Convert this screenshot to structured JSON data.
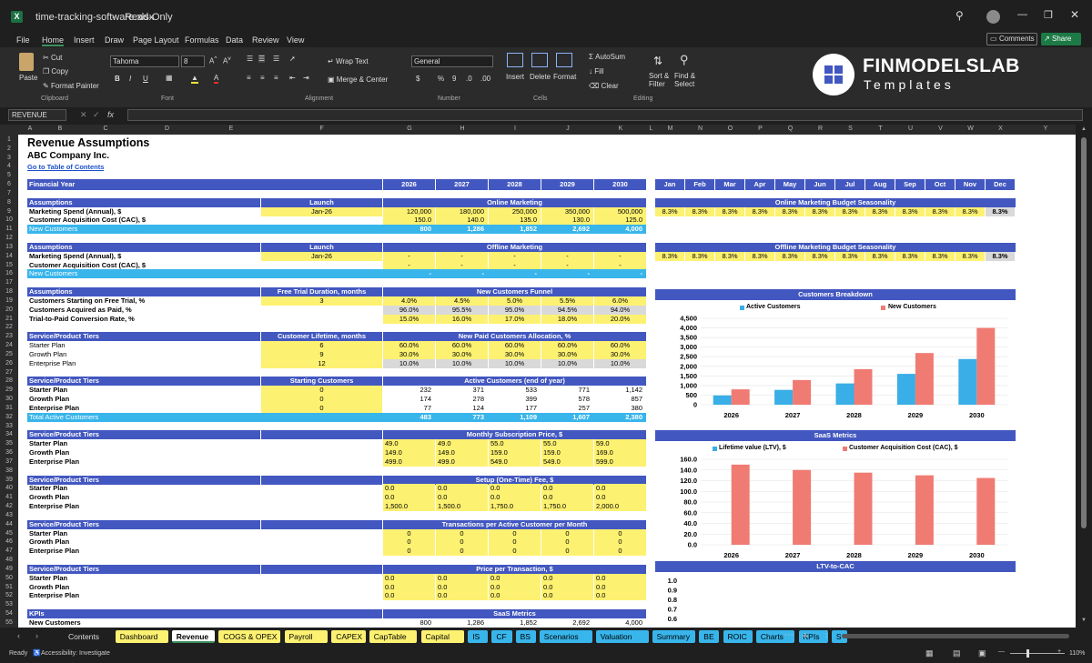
{
  "titlebar": {
    "filename": "time-tracking-software.xlsx",
    "mode": "Read-Only"
  },
  "menu": {
    "items": [
      "File",
      "Home",
      "Insert",
      "Draw",
      "Page Layout",
      "Formulas",
      "Data",
      "Review",
      "View"
    ],
    "comments": "Comments",
    "share": "Share"
  },
  "ribbon": {
    "paste": "Paste",
    "cut": "Cut",
    "copy": "Copy",
    "format_painter": "Format Painter",
    "clipboard": "Clipboard",
    "font_name": "Tahoma",
    "font_size": "8",
    "font": "Font",
    "wrap": "Wrap Text",
    "merge": "Merge & Center",
    "alignment": "Alignment",
    "number_format": "General",
    "number": "Number",
    "insert": "Insert",
    "delete": "Delete",
    "format": "Format",
    "cells": "Cells",
    "autosum": "AutoSum",
    "fill": "Fill",
    "clear": "Clear",
    "sort": "Sort &",
    "filter": "Filter",
    "find": "Find &",
    "select": "Select",
    "editing": "Editing",
    "brand_top": "FINMODELSLAB",
    "brand_bottom": "Templates"
  },
  "formula": {
    "namebox": "REVENUE",
    "fx": "fx",
    "content": ""
  },
  "columns": [
    "A",
    "B",
    "C",
    "D",
    "E",
    "F",
    "G",
    "H",
    "I",
    "J",
    "K",
    "L",
    "M",
    "N",
    "O",
    "P",
    "Q",
    "R",
    "S",
    "T",
    "U",
    "V",
    "W",
    "X",
    "Y"
  ],
  "rows": [
    "1",
    "2",
    "3",
    "4",
    "5",
    "6",
    "7",
    "8",
    "9",
    "10",
    "11",
    "12",
    "13",
    "14",
    "15",
    "16",
    "17",
    "18",
    "19",
    "20",
    "21",
    "22",
    "23",
    "24",
    "25",
    "26",
    "27",
    "28",
    "29",
    "30",
    "31",
    "32",
    "33",
    "34",
    "35",
    "36",
    "37",
    "38",
    "39",
    "40",
    "41",
    "42",
    "43",
    "44",
    "45",
    "46",
    "47",
    "48",
    "49",
    "50",
    "51",
    "52",
    "53",
    "54",
    "55"
  ],
  "sheet": {
    "title": "Revenue Assumptions",
    "company": "ABC Company Inc.",
    "toc": "Go to Table of Contents",
    "financial_year": "Financial Year",
    "years": [
      "2026",
      "2027",
      "2028",
      "2029",
      "2030"
    ],
    "months": [
      "Jan",
      "Feb",
      "Mar",
      "Apr",
      "May",
      "Jun",
      "Jul",
      "Aug",
      "Sep",
      "Oct",
      "Nov",
      "Dec"
    ],
    "assumptions": "Assumptions",
    "launch": "Launch",
    "online_marketing": "Online Marketing",
    "offline_marketing": "Offline Marketing",
    "mkt_spend": "Marketing Spend (Annual), $",
    "cac": "Customer Acquisition Cost (CAC), $",
    "new_customers": "New Customers",
    "online_launch": "Jan-26",
    "online_spend": [
      "120,000",
      "180,000",
      "250,000",
      "350,000",
      "500,000"
    ],
    "online_cac": [
      "150.0",
      "140.0",
      "135.0",
      "130.0",
      "125.0"
    ],
    "online_new": [
      "800",
      "1,286",
      "1,852",
      "2,692",
      "4,000"
    ],
    "offline_launch": "Jan-26",
    "offline_spend": [
      "-",
      "-",
      "-",
      "-",
      "-"
    ],
    "offline_cac": [
      "-",
      "-",
      "-",
      "-",
      "-"
    ],
    "offline_new": [
      "-",
      "-",
      "-",
      "-",
      "-"
    ],
    "online_season_title": "Online Marketing Budget Seasonality",
    "offline_season_title": "Offline Marketing Budget Seasonality",
    "season": [
      "8.3%",
      "8.3%",
      "8.3%",
      "8.3%",
      "8.3%",
      "8.3%",
      "8.3%",
      "8.3%",
      "8.3%",
      "8.3%",
      "8.3%",
      "8.3%"
    ],
    "trial_duration_label": "Free Trial Duration, months",
    "funnel": "New Customers Funnel",
    "trial_duration": "3",
    "funnel_rows": [
      {
        "label": "Customers Starting on Free Trial, %",
        "v": [
          "4.0%",
          "4.5%",
          "5.0%",
          "5.5%",
          "6.0%"
        ]
      },
      {
        "label": "Customers Acquired as Paid, %",
        "v": [
          "96.0%",
          "95.5%",
          "95.0%",
          "94.5%",
          "94.0%"
        ]
      },
      {
        "label": "Trial-to-Paid Conversion Rate, %",
        "v": [
          "15.0%",
          "16.0%",
          "17.0%",
          "18.0%",
          "20.0%"
        ]
      }
    ],
    "tiers": "Service/Product Tiers",
    "lifetime_label": "Customer Lifetime, months",
    "allocation": "New Paid Customers Allocation, %",
    "alloc_rows": [
      {
        "label": "Starter Plan",
        "lt": "6",
        "v": [
          "60.0%",
          "60.0%",
          "60.0%",
          "60.0%",
          "60.0%"
        ]
      },
      {
        "label": "Growth Plan",
        "lt": "9",
        "v": [
          "30.0%",
          "30.0%",
          "30.0%",
          "30.0%",
          "30.0%"
        ]
      },
      {
        "label": "Enterprise Plan",
        "lt": "12",
        "v": [
          "10.0%",
          "10.0%",
          "10.0%",
          "10.0%",
          "10.0%"
        ]
      }
    ],
    "starting_label": "Starting Customers",
    "active_label": "Active Customers (end of year)",
    "active_rows": [
      {
        "label": "Starter Plan",
        "s": "0",
        "v": [
          "232",
          "371",
          "533",
          "771",
          "1,142"
        ]
      },
      {
        "label": "Growth Plan",
        "s": "0",
        "v": [
          "174",
          "278",
          "399",
          "578",
          "857"
        ]
      },
      {
        "label": "Enterprise Plan",
        "s": "0",
        "v": [
          "77",
          "124",
          "177",
          "257",
          "380"
        ]
      }
    ],
    "total_active": "Total Active Customers",
    "total_active_v": [
      "483",
      "773",
      "1,109",
      "1,607",
      "2,380"
    ],
    "price_label": "Monthly Subscription Price, $",
    "price_rows": [
      {
        "label": "Starter Plan",
        "v": [
          "49.0",
          "49.0",
          "55.0",
          "55.0",
          "59.0"
        ]
      },
      {
        "label": "Growth Plan",
        "v": [
          "149.0",
          "149.0",
          "159.0",
          "159.0",
          "169.0"
        ]
      },
      {
        "label": "Enterprise Plan",
        "v": [
          "499.0",
          "499.0",
          "549.0",
          "549.0",
          "599.0"
        ]
      }
    ],
    "setup_label": "Setup (One-Time) Fee, $",
    "setup_rows": [
      {
        "label": "Starter Plan",
        "v": [
          "0.0",
          "0.0",
          "0.0",
          "0.0",
          "0.0"
        ]
      },
      {
        "label": "Growth Plan",
        "v": [
          "0.0",
          "0.0",
          "0.0",
          "0.0",
          "0.0"
        ]
      },
      {
        "label": "Enterprise Plan",
        "v": [
          "1,500.0",
          "1,500.0",
          "1,750.0",
          "1,750.0",
          "2,000.0"
        ]
      }
    ],
    "trans_label": "Transactions per Active Customer per Month",
    "trans_rows": [
      {
        "label": "Starter Plan",
        "v": [
          "0",
          "0",
          "0",
          "0",
          "0"
        ]
      },
      {
        "label": "Growth Plan",
        "v": [
          "0",
          "0",
          "0",
          "0",
          "0"
        ]
      },
      {
        "label": "Enterprise Plan",
        "v": [
          "0",
          "0",
          "0",
          "0",
          "0"
        ]
      }
    ],
    "ppt_label": "Price per Transaction, $",
    "ppt_rows": [
      {
        "label": "Starter Plan",
        "v": [
          "0.0",
          "0.0",
          "0.0",
          "0.0",
          "0.0"
        ]
      },
      {
        "label": "Growth Plan",
        "v": [
          "0.0",
          "0.0",
          "0.0",
          "0.0",
          "0.0"
        ]
      },
      {
        "label": "Enterprise Plan",
        "v": [
          "0.0",
          "0.0",
          "0.0",
          "0.0",
          "0.0"
        ]
      }
    ],
    "kpis": "KPIs",
    "saas_metrics": "SaaS Metrics",
    "kpi_new": "New Customers",
    "kpi_new_v": [
      "800",
      "1,286",
      "1,852",
      "2,692",
      "4,000"
    ]
  },
  "chart_data": [
    {
      "type": "bar",
      "title": "Customers Breakdown",
      "categories": [
        "2026",
        "2027",
        "2028",
        "2029",
        "2030"
      ],
      "ylim": [
        0,
        4500
      ],
      "yticks": [
        "4,500",
        "4,000",
        "3,500",
        "3,000",
        "2,500",
        "2,000",
        "1,500",
        "1,000",
        "500",
        "0"
      ],
      "series": [
        {
          "name": "Active Customers",
          "color": "#3aaee6",
          "values": [
            483,
            773,
            1109,
            1607,
            2380
          ]
        },
        {
          "name": "New Customers",
          "color": "#f07b72",
          "values": [
            800,
            1286,
            1852,
            2692,
            4000
          ]
        }
      ]
    },
    {
      "type": "bar",
      "title": "SaaS Metrics",
      "categories": [
        "2026",
        "2027",
        "2028",
        "2029",
        "2030"
      ],
      "ylim": [
        0,
        160
      ],
      "yticks": [
        "160.0",
        "140.0",
        "120.0",
        "100.0",
        "80.0",
        "60.0",
        "40.0",
        "20.0",
        "0.0"
      ],
      "series": [
        {
          "name": "Lifetime value (LTV), $",
          "color": "#3aaee6",
          "values": [
            0,
            0,
            0,
            0,
            0
          ]
        },
        {
          "name": "Customer Acquisition Cost (CAC), $",
          "color": "#f07b72",
          "values": [
            150,
            140,
            135,
            130,
            125
          ]
        }
      ]
    },
    {
      "type": "bar",
      "title": "LTV-to-CAC",
      "categories": [],
      "yticks": [
        "1.0",
        "0.9",
        "0.8",
        "0.7",
        "0.6"
      ],
      "series": []
    }
  ],
  "tabs": [
    "Contents",
    "Dashboard",
    "Revenue",
    "COGS & OPEX",
    "Payroll",
    "CAPEX",
    "CapTable",
    "Capital",
    "IS",
    "CF",
    "BS",
    "Scenarios",
    "Valuation",
    "Summary",
    "BE",
    "ROIC",
    "Charts",
    "KPIs",
    "S"
  ],
  "status": {
    "ready": "Ready",
    "accessibility": "Accessibility: Investigate",
    "zoom": "110%"
  }
}
